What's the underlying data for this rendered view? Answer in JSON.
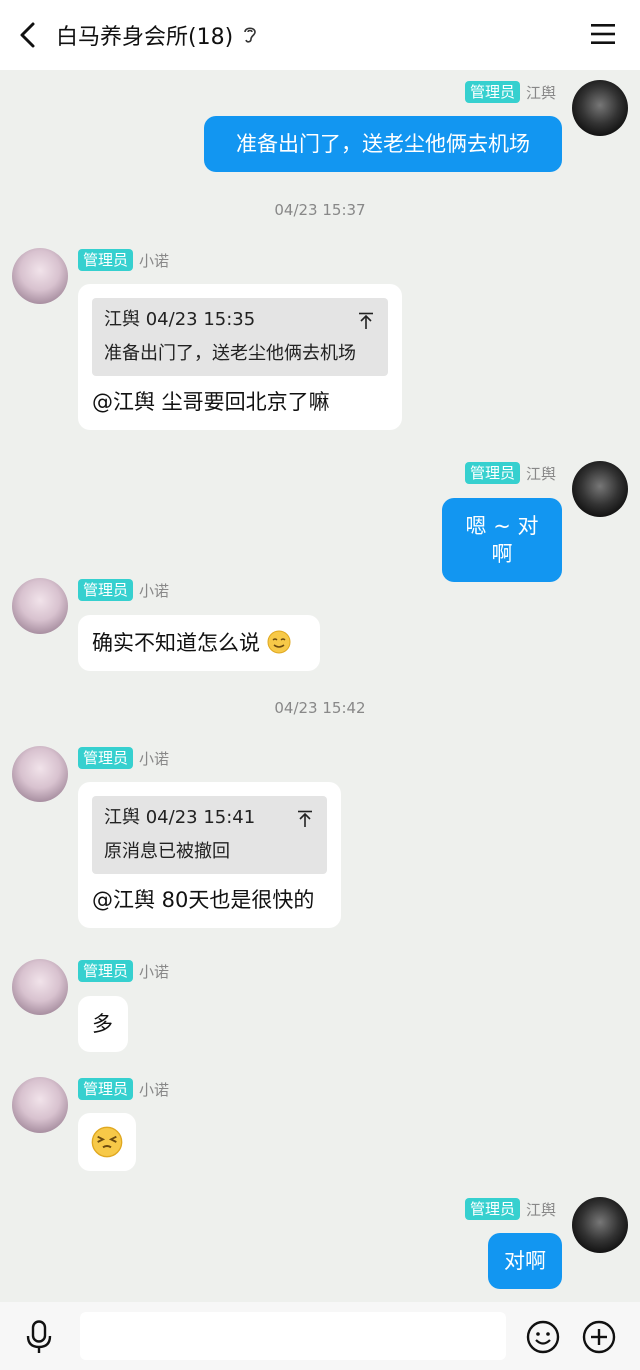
{
  "header": {
    "title": "白马养身会所(18)"
  },
  "messages": {
    "m1": {
      "role": "管理员",
      "name": "江舆",
      "text": "准备出门了，送老尘他俩去机场"
    },
    "t1": "04/23 15:37",
    "m2": {
      "role": "管理员",
      "name": "小诺",
      "quote_head": "江舆 04/23 15:35",
      "quote_body": "准备出门了，送老尘他俩去机场",
      "text": "@江舆 尘哥要回北京了嘛"
    },
    "m3": {
      "role": "管理员",
      "name": "江舆",
      "text": "嗯 ~ 对啊"
    },
    "m4": {
      "role": "管理员",
      "name": "小诺",
      "text": "确实不知道怎么说",
      "emoji": "smile-emoji"
    },
    "t2": "04/23 15:42",
    "m5": {
      "role": "管理员",
      "name": "小诺",
      "quote_head": "江舆 04/23 15:41",
      "quote_body": "原消息已被撤回",
      "text": "@江舆 80天也是很快的"
    },
    "m6": {
      "role": "管理员",
      "name": "小诺",
      "text": "多"
    },
    "m7": {
      "role": "管理员",
      "name": "小诺",
      "emoji": "squint-emoji"
    },
    "m8": {
      "role": "管理员",
      "name": "江舆",
      "text": "对啊"
    }
  },
  "icons": {
    "back": "back-arrow-icon",
    "ear": "ear-icon",
    "menu": "menu-icon",
    "mic": "microphone-icon",
    "smile": "smiley-icon",
    "plus": "plus-circle-icon",
    "quote_arrow": "scroll-to-top-icon"
  },
  "colors": {
    "bubble_blue": "#1296f1",
    "badge": "#36d0cf",
    "chat_bg": "#eef0ed"
  }
}
